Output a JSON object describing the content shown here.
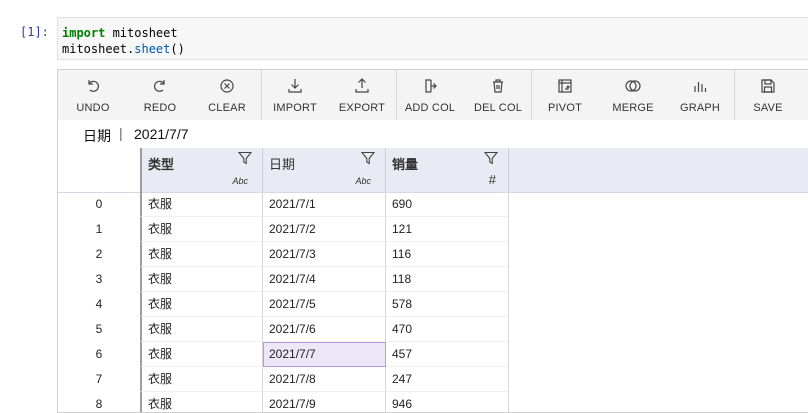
{
  "notebook": {
    "prompt": "[1]:",
    "code_line1_keyword": "import",
    "code_line1_rest": " mitosheet",
    "code_line2_object": "mitosheet.",
    "code_line2_call": "sheet",
    "code_line2_tail": "()"
  },
  "toolbar": {
    "buttons": [
      {
        "label": "UNDO",
        "icon": "undo-icon"
      },
      {
        "label": "REDO",
        "icon": "redo-icon"
      },
      {
        "label": "CLEAR",
        "icon": "clear-icon"
      },
      {
        "label": "IMPORT",
        "icon": "import-icon"
      },
      {
        "label": "EXPORT",
        "icon": "export-icon"
      },
      {
        "label": "ADD COL",
        "icon": "add-column-icon"
      },
      {
        "label": "DEL COL",
        "icon": "trash-icon"
      },
      {
        "label": "PIVOT",
        "icon": "pivot-icon"
      },
      {
        "label": "MERGE",
        "icon": "merge-icon"
      },
      {
        "label": "GRAPH",
        "icon": "graph-icon"
      },
      {
        "label": "SAVE",
        "icon": "save-icon"
      }
    ]
  },
  "formula_bar": {
    "column": "日期",
    "separator": "|",
    "value": "2021/7/7"
  },
  "table": {
    "columns": [
      {
        "name": "类型",
        "dtype": "Abc"
      },
      {
        "name": "日期",
        "dtype": "Abc"
      },
      {
        "name": "销量",
        "dtype": "#"
      }
    ],
    "rows": [
      {
        "index": "0",
        "cells": [
          "衣服",
          "2021/7/1",
          "690"
        ]
      },
      {
        "index": "1",
        "cells": [
          "衣服",
          "2021/7/2",
          "121"
        ]
      },
      {
        "index": "2",
        "cells": [
          "衣服",
          "2021/7/3",
          "116"
        ]
      },
      {
        "index": "3",
        "cells": [
          "衣服",
          "2021/7/4",
          "118"
        ]
      },
      {
        "index": "4",
        "cells": [
          "衣服",
          "2021/7/5",
          "578"
        ]
      },
      {
        "index": "5",
        "cells": [
          "衣服",
          "2021/7/6",
          "470"
        ]
      },
      {
        "index": "6",
        "cells": [
          "衣服",
          "2021/7/7",
          "457"
        ]
      },
      {
        "index": "7",
        "cells": [
          "衣服",
          "2021/7/8",
          "247"
        ]
      },
      {
        "index": "8",
        "cells": [
          "衣服",
          "2021/7/9",
          "946"
        ]
      }
    ],
    "selected_row": 6,
    "selected_col": 1
  }
}
